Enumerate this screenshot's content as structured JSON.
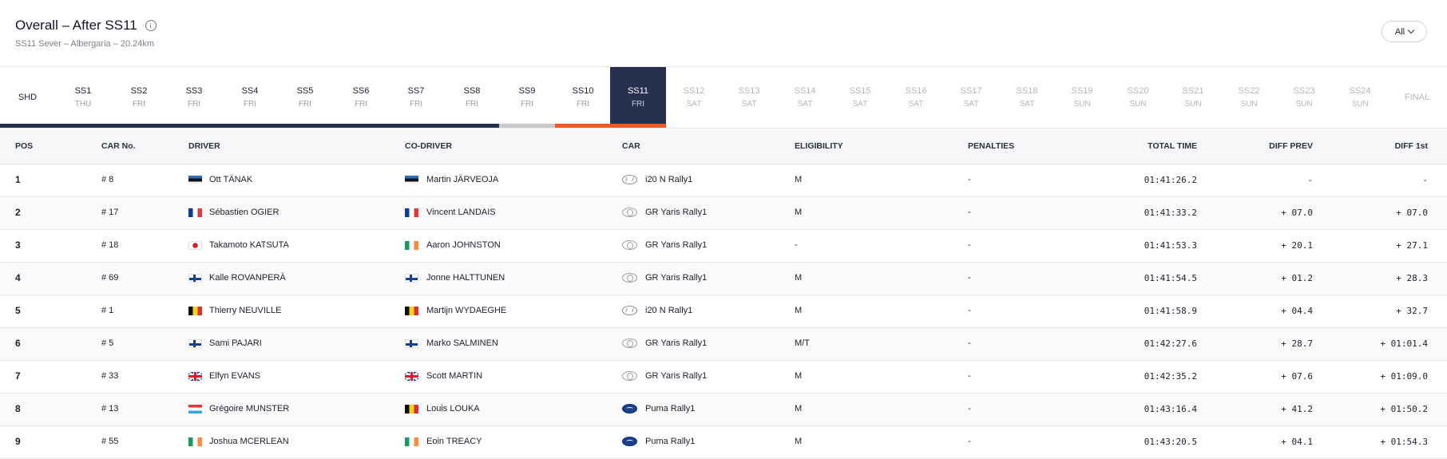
{
  "header": {
    "title": "Overall – After SS11",
    "subtitle": "SS11 Sever – Albergaria – 20.24km",
    "filter_label": "All"
  },
  "stages": [
    {
      "name": "SHD",
      "day": "",
      "state": "done"
    },
    {
      "name": "SS1",
      "day": "THU",
      "state": "done"
    },
    {
      "name": "SS2",
      "day": "FRI",
      "state": "done"
    },
    {
      "name": "SS3",
      "day": "FRI",
      "state": "done"
    },
    {
      "name": "SS4",
      "day": "FRI",
      "state": "done"
    },
    {
      "name": "SS5",
      "day": "FRI",
      "state": "done"
    },
    {
      "name": "SS6",
      "day": "FRI",
      "state": "done"
    },
    {
      "name": "SS7",
      "day": "FRI",
      "state": "done"
    },
    {
      "name": "SS8",
      "day": "FRI",
      "state": "done"
    },
    {
      "name": "SS9",
      "day": "FRI",
      "state": "done"
    },
    {
      "name": "SS10",
      "day": "FRI",
      "state": "done"
    },
    {
      "name": "SS11",
      "day": "FRI",
      "state": "active"
    },
    {
      "name": "SS12",
      "day": "SAT",
      "state": "future"
    },
    {
      "name": "SS13",
      "day": "SAT",
      "state": "future"
    },
    {
      "name": "SS14",
      "day": "SAT",
      "state": "future"
    },
    {
      "name": "SS15",
      "day": "SAT",
      "state": "future"
    },
    {
      "name": "SS16",
      "day": "SAT",
      "state": "future"
    },
    {
      "name": "SS17",
      "day": "SAT",
      "state": "future"
    },
    {
      "name": "SS18",
      "day": "SAT",
      "state": "future"
    },
    {
      "name": "SS19",
      "day": "SUN",
      "state": "future"
    },
    {
      "name": "SS20",
      "day": "SUN",
      "state": "future"
    },
    {
      "name": "SS21",
      "day": "SUN",
      "state": "future"
    },
    {
      "name": "SS22",
      "day": "SUN",
      "state": "future"
    },
    {
      "name": "SS23",
      "day": "SUN",
      "state": "future"
    },
    {
      "name": "SS24",
      "day": "SUN",
      "state": "future"
    },
    {
      "name": "FINAL",
      "day": "",
      "state": "future"
    }
  ],
  "table": {
    "columns": {
      "pos": "POS",
      "car_no": "CAR No.",
      "driver": "DRIVER",
      "co_driver": "CO-DRIVER",
      "car": "CAR",
      "eligibility": "ELIGIBILITY",
      "penalties": "PENALTIES",
      "total_time": "TOTAL TIME",
      "diff_prev": "DIFF PREV",
      "diff_first": "DIFF 1st"
    },
    "rows": [
      {
        "pos": "1",
        "car_no": "# 8",
        "driver": "Ott TÄNAK",
        "driver_flag": "est",
        "co_driver": "Martin JÄRVEOJA",
        "co_flag": "est",
        "car": "i20 N Rally1",
        "make": "hyundai",
        "eligibility": "M",
        "penalties": "-",
        "total_time": "01:41:26.2",
        "diff_prev": "-",
        "diff_first": "-"
      },
      {
        "pos": "2",
        "car_no": "# 17",
        "driver": "Sébastien OGIER",
        "driver_flag": "fra",
        "co_driver": "Vincent LANDAIS",
        "co_flag": "fra",
        "car": "GR Yaris Rally1",
        "make": "toyota",
        "eligibility": "M",
        "penalties": "-",
        "total_time": "01:41:33.2",
        "diff_prev": "+ 07.0",
        "diff_first": "+ 07.0"
      },
      {
        "pos": "3",
        "car_no": "# 18",
        "driver": "Takamoto KATSUTA",
        "driver_flag": "jpn",
        "co_driver": "Aaron JOHNSTON",
        "co_flag": "irl",
        "car": "GR Yaris Rally1",
        "make": "toyota",
        "eligibility": "-",
        "penalties": "-",
        "total_time": "01:41:53.3",
        "diff_prev": "+ 20.1",
        "diff_first": "+ 27.1"
      },
      {
        "pos": "4",
        "car_no": "# 69",
        "driver": "Kalle ROVANPERÄ",
        "driver_flag": "fin",
        "co_driver": "Jonne HALTTUNEN",
        "co_flag": "fin",
        "car": "GR Yaris Rally1",
        "make": "toyota",
        "eligibility": "M",
        "penalties": "-",
        "total_time": "01:41:54.5",
        "diff_prev": "+ 01.2",
        "diff_first": "+ 28.3"
      },
      {
        "pos": "5",
        "car_no": "# 1",
        "driver": "Thierry NEUVILLE",
        "driver_flag": "bel",
        "co_driver": "Martijn WYDAEGHE",
        "co_flag": "bel",
        "car": "i20 N Rally1",
        "make": "hyundai",
        "eligibility": "M",
        "penalties": "-",
        "total_time": "01:41:58.9",
        "diff_prev": "+ 04.4",
        "diff_first": "+ 32.7"
      },
      {
        "pos": "6",
        "car_no": "# 5",
        "driver": "Sami PAJARI",
        "driver_flag": "fin",
        "co_driver": "Marko SALMINEN",
        "co_flag": "fin",
        "car": "GR Yaris Rally1",
        "make": "toyota",
        "eligibility": "M/T",
        "penalties": "-",
        "total_time": "01:42:27.6",
        "diff_prev": "+ 28.7",
        "diff_first": "+ 01:01.4"
      },
      {
        "pos": "7",
        "car_no": "# 33",
        "driver": "Elfyn EVANS",
        "driver_flag": "gbr",
        "co_driver": "Scott MARTIN",
        "co_flag": "gbr",
        "car": "GR Yaris Rally1",
        "make": "toyota",
        "eligibility": "M",
        "penalties": "-",
        "total_time": "01:42:35.2",
        "diff_prev": "+ 07.6",
        "diff_first": "+ 01:09.0"
      },
      {
        "pos": "8",
        "car_no": "# 13",
        "driver": "Grégoire MUNSTER",
        "driver_flag": "lux",
        "co_driver": "Louis LOUKA",
        "co_flag": "bel",
        "car": "Puma Rally1",
        "make": "ford",
        "eligibility": "M",
        "penalties": "-",
        "total_time": "01:43:16.4",
        "diff_prev": "+ 41.2",
        "diff_first": "+ 01:50.2"
      },
      {
        "pos": "9",
        "car_no": "# 55",
        "driver": "Joshua MCERLEAN",
        "driver_flag": "irl",
        "co_driver": "Eoin TREACY",
        "co_flag": "irl",
        "car": "Puma Rally1",
        "make": "ford",
        "eligibility": "M",
        "penalties": "-",
        "total_time": "01:43:20.5",
        "diff_prev": "+ 04.1",
        "diff_first": "+ 01:54.3"
      }
    ]
  },
  "colors": {
    "active_stage": "#27314f",
    "progress_navy": "#27314f",
    "progress_grey": "#c7c9cd",
    "progress_orange": "#f05a1e"
  }
}
